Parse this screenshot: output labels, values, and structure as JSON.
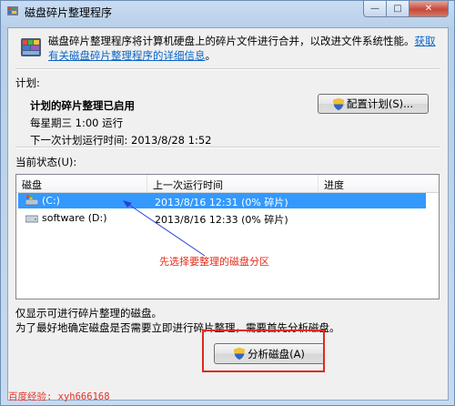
{
  "window": {
    "title": "磁盘碎片整理程序",
    "controls": {
      "minimize": "—",
      "maximize": "□",
      "close": "✕"
    }
  },
  "intro": {
    "text": "磁盘碎片整理程序将计算机硬盘上的碎片文件进行合并，以改进文件系统性能。",
    "link": "获取有关磁盘碎片整理程序的详细信息",
    "tail": "。"
  },
  "schedule": {
    "section_label": "计划:",
    "status": "计划的碎片整理已启用",
    "frequency": "每星期三  1:00 运行",
    "next_run": "下一次计划运行时间: 2013/8/28 1:52",
    "configure_button": "配置计划(S)..."
  },
  "current_status": {
    "label": "当前状态(U):",
    "columns": [
      "磁盘",
      "上一次运行时间",
      "进度"
    ],
    "rows": [
      {
        "disk": "(C:)",
        "last_run": "2013/8/16 12:31 (0% 碎片)",
        "progress": "",
        "selected": true
      },
      {
        "disk": "software (D:)",
        "last_run": "2013/8/16 12:33 (0% 碎片)",
        "progress": "",
        "selected": false
      }
    ],
    "annotation": "先选择要整理的磁盘分区"
  },
  "footer": {
    "line1": "仅显示可进行碎片整理的磁盘。",
    "line2": "为了最好地确定磁盘是否需要立即进行碎片整理，需要首先分析磁盘。",
    "analyze_button": "分析磁盘(A)"
  },
  "watermark": "百度经验: xyh666168",
  "colors": {
    "selection": "#3399ff",
    "annotation": "#e52a1a",
    "link": "#0b65c6"
  }
}
